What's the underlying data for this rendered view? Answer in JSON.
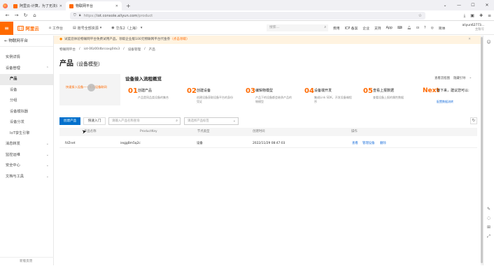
{
  "browser": {
    "tabs": [
      {
        "label": "阿里云-计算，为了无法计算的..."
      },
      {
        "label": "物联网平台"
      }
    ],
    "new_tab": "+",
    "url_prefix": "https://",
    "url_host": "iot.console.aliyun.com",
    "url_path": "/product"
  },
  "header": {
    "logo_text": "阿里云",
    "workbench": "工作台",
    "account_label": "账号全部资源",
    "region_label": "华东2（上海）",
    "search_placeholder": "搜索...",
    "links": [
      "费用",
      "ICP 备案",
      "企业",
      "支持",
      "App"
    ],
    "lang": "简体",
    "user_name": "aliyun62773...",
    "user_sub": "主账号"
  },
  "sidebar": {
    "title": "物联网平台",
    "items": [
      {
        "label": "实例详情",
        "type": "item"
      },
      {
        "label": "设备管理",
        "type": "group"
      },
      {
        "label": "产品",
        "type": "sub",
        "active": true
      },
      {
        "label": "设备",
        "type": "sub"
      },
      {
        "label": "分组",
        "type": "sub"
      },
      {
        "label": "设备模拟器",
        "type": "sub"
      },
      {
        "label": "设备分发",
        "type": "sub"
      },
      {
        "label": "IoT孪生引擎",
        "type": "sub"
      },
      {
        "label": "消息转发",
        "type": "group"
      },
      {
        "label": "监控运维",
        "type": "group"
      },
      {
        "label": "安全中心",
        "type": "group"
      },
      {
        "label": "文档与工具",
        "type": "item"
      }
    ],
    "footer": "新版反馈"
  },
  "notice": {
    "text": "试度您体验物联网平台免费试用产品。领取企业版100元物联网平台代金券",
    "link": "（点击领取）"
  },
  "breadcrumb": [
    "物联网平台",
    "/",
    "iot-06z00dbrcoxg0dx3",
    "/",
    "设备管理",
    "/",
    "产品"
  ],
  "page_title": "产品",
  "page_subtitle": "（设备模型）",
  "guide": {
    "thumb_text": "快速接入设备——实现设备联网",
    "title": "设备接入流程概览",
    "links": [
      "查看流程图",
      "隐藏引导"
    ],
    "steps": [
      {
        "num": "01",
        "title": "创建产品",
        "desc": "产品是同品类设备的集合",
        "link": ""
      },
      {
        "num": "02",
        "title": "创建设备",
        "desc": "创建设备获取设备平台的身份凭证",
        "link": ""
      },
      {
        "num": "03",
        "title": "编辑物模型",
        "desc": "产品下的设备都会继承产品的物模型",
        "link": ""
      },
      {
        "num": "04",
        "title": "设备端开发",
        "desc": "集成Link SDK，开发设备端程序",
        "link": ""
      },
      {
        "num": "05",
        "title": "查看上报数据",
        "desc": "查看设备上报的属性数据",
        "link": ""
      },
      {
        "num": "Next",
        "title": "接下来，建议您可以:",
        "desc": "",
        "link": "配置数据流转"
      }
    ]
  },
  "toolbar": {
    "create_label": "创建产品",
    "quickstart_label": "快速入门",
    "search_placeholder": "请输入产品名称查询",
    "select_placeholder": "请选择产品标签",
    "refresh_icon": "refresh-icon"
  },
  "table": {
    "headers": [
      "产品名称",
      "ProductKey",
      "节点类型",
      "创建时间",
      "操作"
    ],
    "rows": [
      {
        "name": "IVZnet",
        "key": "ieqjgBm5q2c",
        "node": "设备",
        "created": "2022/11/29 08:47:03",
        "ops": [
          "查看",
          "管理设备",
          "删除"
        ]
      }
    ]
  }
}
